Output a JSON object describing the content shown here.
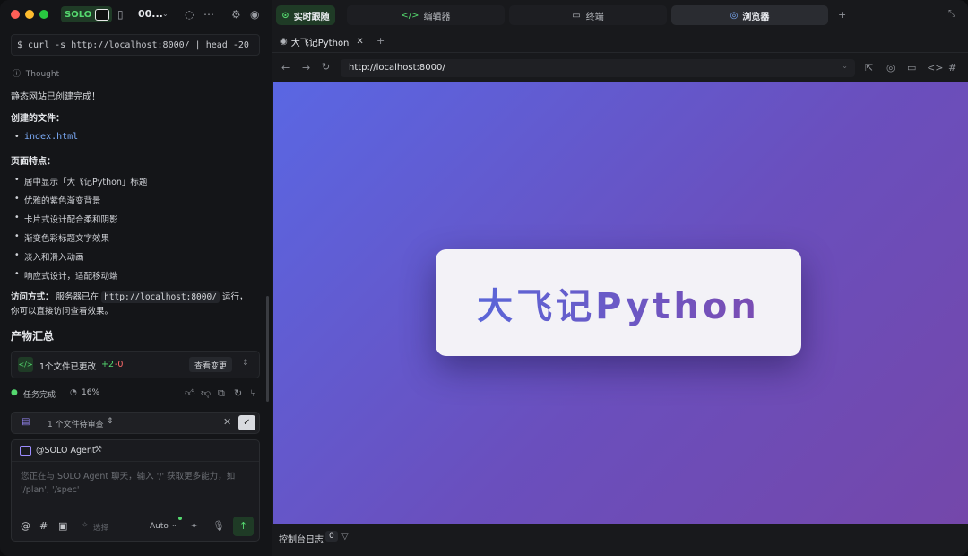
{
  "window": {
    "app_badge": "SOLO",
    "project_name": "00...",
    "traffic_lights": {
      "close": "#ff5f57",
      "minimize": "#febc2e",
      "maximize": "#28c840"
    }
  },
  "chat": {
    "command": "$ curl -s http://localhost:8000/ | head -20",
    "thought_label": "Thought",
    "done_msg": "静态网站已创建完成！",
    "files_heading": "创建的文件：",
    "file": "index.html",
    "features_heading": "页面特点：",
    "features": [
      "居中显示「大飞记Python」标题",
      "优雅的紫色渐变背景",
      "卡片式设计配合柔和阴影",
      "渐变色彩标题文字效果",
      "淡入和滑入动画",
      "响应式设计，适配移动端"
    ],
    "access_label": "访问方式：",
    "access_text_1": "服务器已在",
    "access_url": "http://localhost:8000/",
    "access_text_2": "运行，",
    "access_text_3": "你可以直接访问查看效果。"
  },
  "summary": {
    "title": "产物汇总",
    "changed_files": "1个文件已更改",
    "added": "+2",
    "removed": "-0",
    "view_changes": "查看变更",
    "task_status": "任务完成",
    "progress": "16%",
    "progress_value": 0.16
  },
  "pending": {
    "label": "1 个文件待审查"
  },
  "composer": {
    "agent": "@SOLO Agent",
    "placeholder": "您正在与 SOLO Agent 聊天，输入 '/' 获取更多能力，如 '/plan', '/spec'",
    "select_label": "选择",
    "mode": "Auto"
  },
  "right_tabs": [
    {
      "label": "实时跟随",
      "icon": "follow-icon"
    },
    {
      "label": "编辑器",
      "icon": "code-icon"
    },
    {
      "label": "终端",
      "icon": "terminal-icon"
    },
    {
      "label": "浏览器",
      "icon": "compass-icon"
    }
  ],
  "browser": {
    "tab_title": "大飞记Python",
    "url": "http://localhost:8000/",
    "page_heading": "大飞记Python"
  },
  "console": {
    "label": "控制台日志",
    "count": "0"
  },
  "colors": {
    "accent_green": "#55d96f",
    "gradient_start": "#5a67e3",
    "gradient_end": "#7447aa"
  }
}
